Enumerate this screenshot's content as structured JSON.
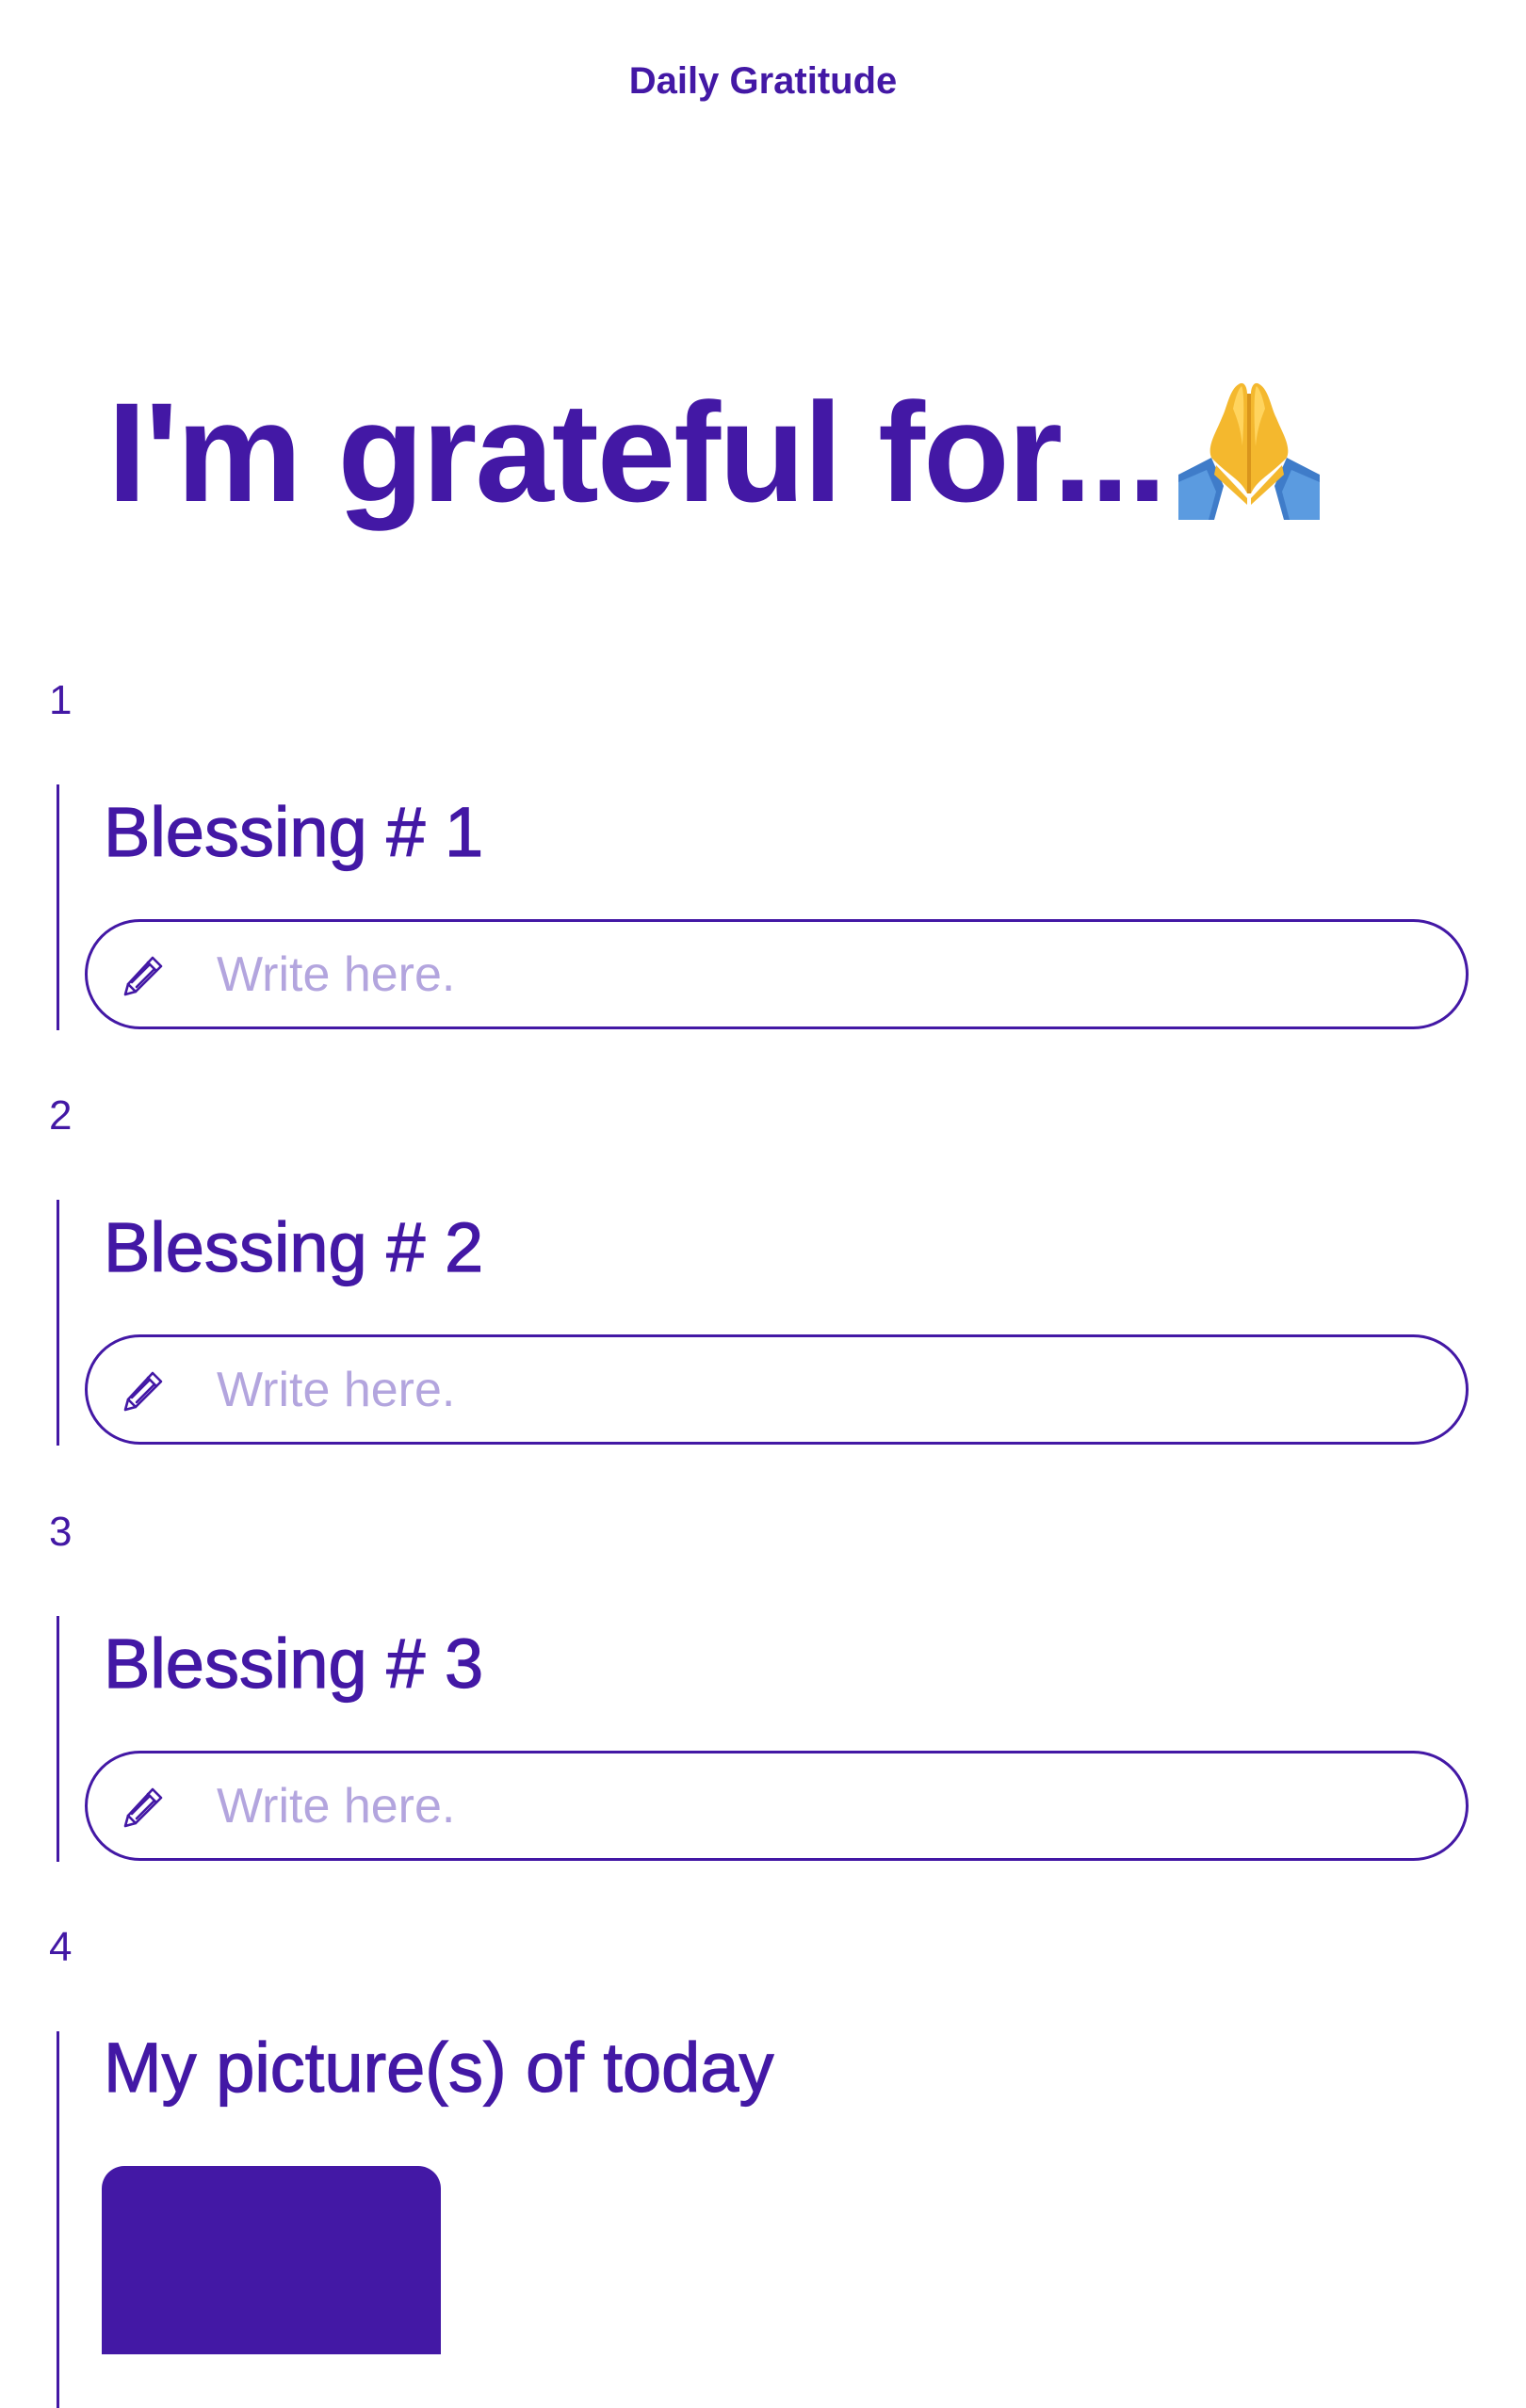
{
  "header": {
    "title": "Daily Gratitude"
  },
  "page": {
    "title": "I'm grateful for...",
    "title_emoji": "folded-hands"
  },
  "theme": {
    "accent": "#4318A5",
    "placeholder": "#B3A5DE",
    "background": "#FFFFFF"
  },
  "sections": [
    {
      "number": "1",
      "heading": "Blessing # 1",
      "input": {
        "value": "",
        "placeholder": "Write here.",
        "icon": "pencil-icon"
      }
    },
    {
      "number": "2",
      "heading": "Blessing # 2",
      "input": {
        "value": "",
        "placeholder": "Write here.",
        "icon": "pencil-icon"
      }
    },
    {
      "number": "3",
      "heading": "Blessing # 3",
      "input": {
        "value": "",
        "placeholder": "Write here.",
        "icon": "pencil-icon"
      }
    },
    {
      "number": "4",
      "heading": "My picture(s) of today",
      "upload": {
        "label": ""
      }
    }
  ]
}
